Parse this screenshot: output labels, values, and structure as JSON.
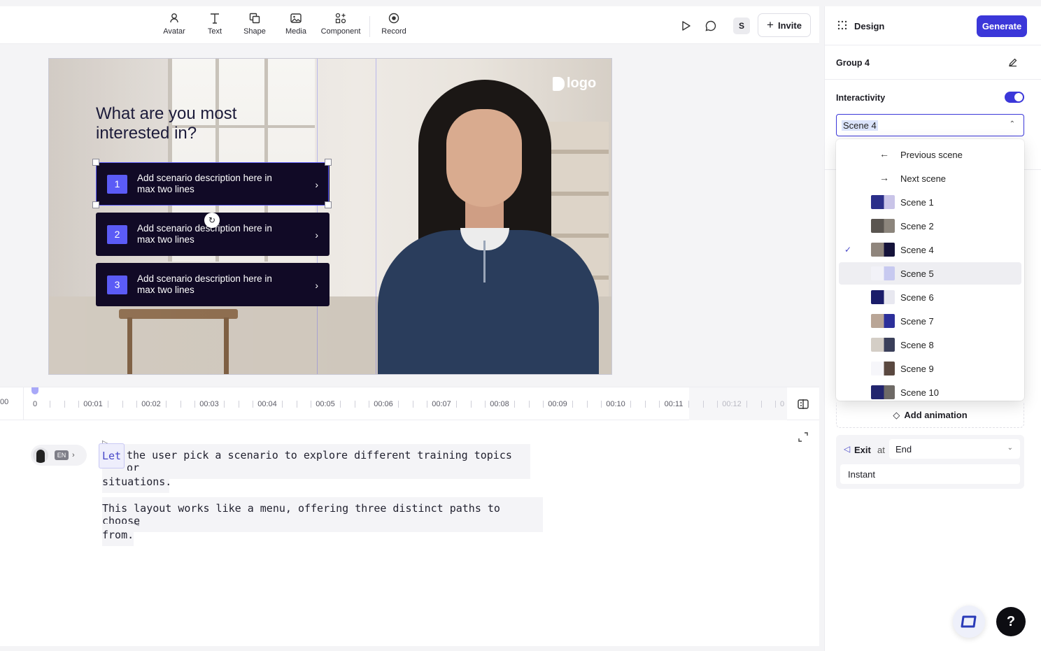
{
  "toolbar": {
    "tools": [
      "Avatar",
      "Text",
      "Shape",
      "Media",
      "Component",
      "Record"
    ],
    "user_initial": "S",
    "invite_label": "Invite"
  },
  "slide": {
    "title": "What are you most interested in?",
    "logo_text": "logo",
    "options": [
      {
        "num": "1",
        "text": "Add scenario description here in max two lines"
      },
      {
        "num": "2",
        "text": "Add scenario description here in max two lines"
      },
      {
        "num": "3",
        "text": "Add scenario description here in max two lines"
      }
    ]
  },
  "timeline": {
    "start_label": "00",
    "labels": [
      "0",
      "00:01",
      "00:02",
      "00:03",
      "00:04",
      "00:05",
      "00:06",
      "00:07",
      "00:08",
      "00:09",
      "00:10",
      "00:11",
      "00:12",
      "0"
    ]
  },
  "script": {
    "language": "EN",
    "first_word": "Let",
    "line1_rest": " the user pick a scenario to explore different training topics or",
    "line2": "situations.",
    "line3": "This layout works like a menu, offering three distinct paths to choose",
    "line4": "from."
  },
  "panel": {
    "title": "Design",
    "generate_label": "Generate",
    "group_name": "Group 4",
    "interactivity_label": "Interactivity",
    "interactivity_on": true,
    "selected_scene": "Scene 4",
    "dropdown_items": [
      {
        "label": "Previous scene",
        "type": "nav",
        "icon": "arrow-left-icon"
      },
      {
        "label": "Next scene",
        "type": "nav",
        "icon": "arrow-right-icon"
      },
      {
        "label": "Scene 1",
        "type": "scene"
      },
      {
        "label": "Scene 2",
        "type": "scene"
      },
      {
        "label": "Scene 4",
        "type": "scene",
        "selected": true
      },
      {
        "label": "Scene 5",
        "type": "scene",
        "highlighted": true
      },
      {
        "label": "Scene 6",
        "type": "scene"
      },
      {
        "label": "Scene 7",
        "type": "scene"
      },
      {
        "label": "Scene 8",
        "type": "scene"
      },
      {
        "label": "Scene 9",
        "type": "scene"
      },
      {
        "label": "Scene 10",
        "type": "scene"
      }
    ],
    "add_animation_label": "Add animation",
    "exit_label": "Exit",
    "exit_at": "at",
    "exit_value": "End",
    "exit_transition": "Instant"
  },
  "colors": {
    "accent": "#3b37d9",
    "option_bg": "#110a26",
    "option_num": "#5b5bf6"
  }
}
